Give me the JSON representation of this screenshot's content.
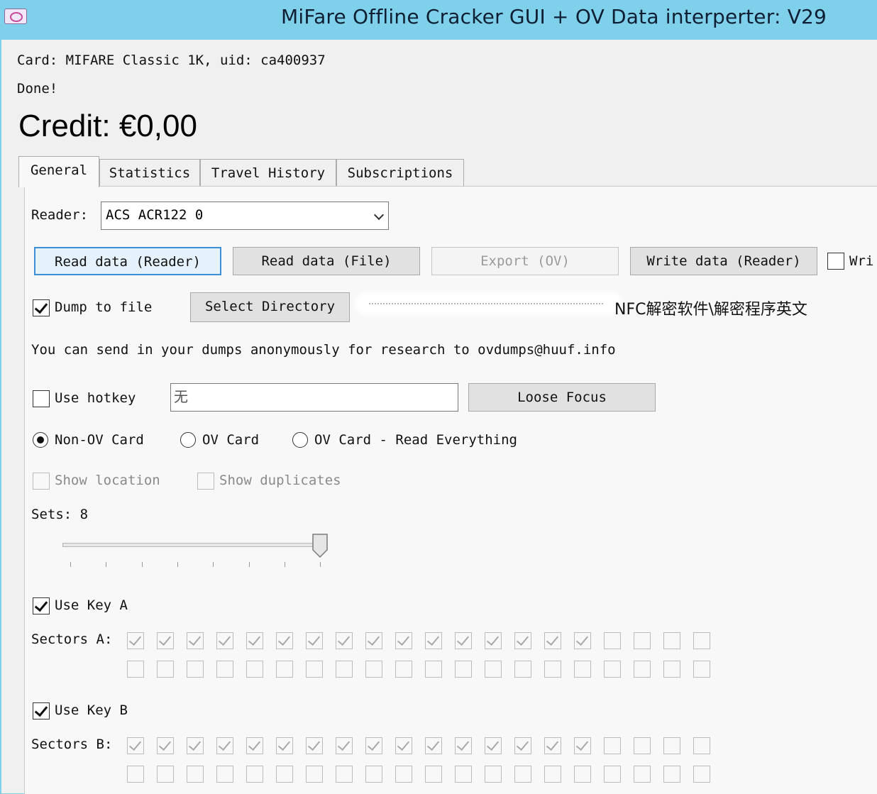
{
  "window": {
    "title": "MiFare Offline Cracker GUI + OV Data interperter: V29",
    "icon": "app-icon"
  },
  "card_info": "Card: MIFARE Classic 1K, uid: ca400937",
  "status": "Done!",
  "credit": "Credit: €0,00",
  "tabs": [
    "General",
    "Statistics",
    "Travel History",
    "Subscriptions"
  ],
  "reader": {
    "label": "Reader:",
    "value": "ACS ACR122 0"
  },
  "buttons": {
    "read_reader": "Read data (Reader)",
    "read_file": "Read data (File)",
    "export": "Export (OV)",
    "write_reader": "Write data (Reader)",
    "select_directory": "Select Directory",
    "loose_focus": "Loose Focus"
  },
  "write_option_label": "Wri",
  "dump_to_file": {
    "label": "Dump to file",
    "checked": true
  },
  "directory_path": "NFC解密软件\\解密程序英文",
  "info_text": "You can send in your dumps anonymously for research to ovdumps@huuf.info",
  "hotkey": {
    "label": "Use hotkey",
    "checked": false,
    "value": "无"
  },
  "card_type": {
    "options": [
      "Non-OV Card",
      "OV Card",
      "OV Card - Read Everything"
    ],
    "selected": "Non-OV Card"
  },
  "show_location": "Show location",
  "show_duplicates": "Show duplicates",
  "sets": {
    "label": "Sets: 8",
    "value": 8,
    "max": 8
  },
  "key_a": {
    "label": "Use Key A",
    "checked": true,
    "sectors_label": "Sectors A:",
    "checked_count": 16,
    "total": 40
  },
  "key_b": {
    "label": "Use Key B",
    "checked": true,
    "sectors_label": "Sectors B:",
    "checked_count": 16,
    "total": 40
  },
  "colors": {
    "titlebar": "#7fd0ea",
    "primary_button": "#e5f1fb",
    "primary_border": "#3c8fd6"
  }
}
